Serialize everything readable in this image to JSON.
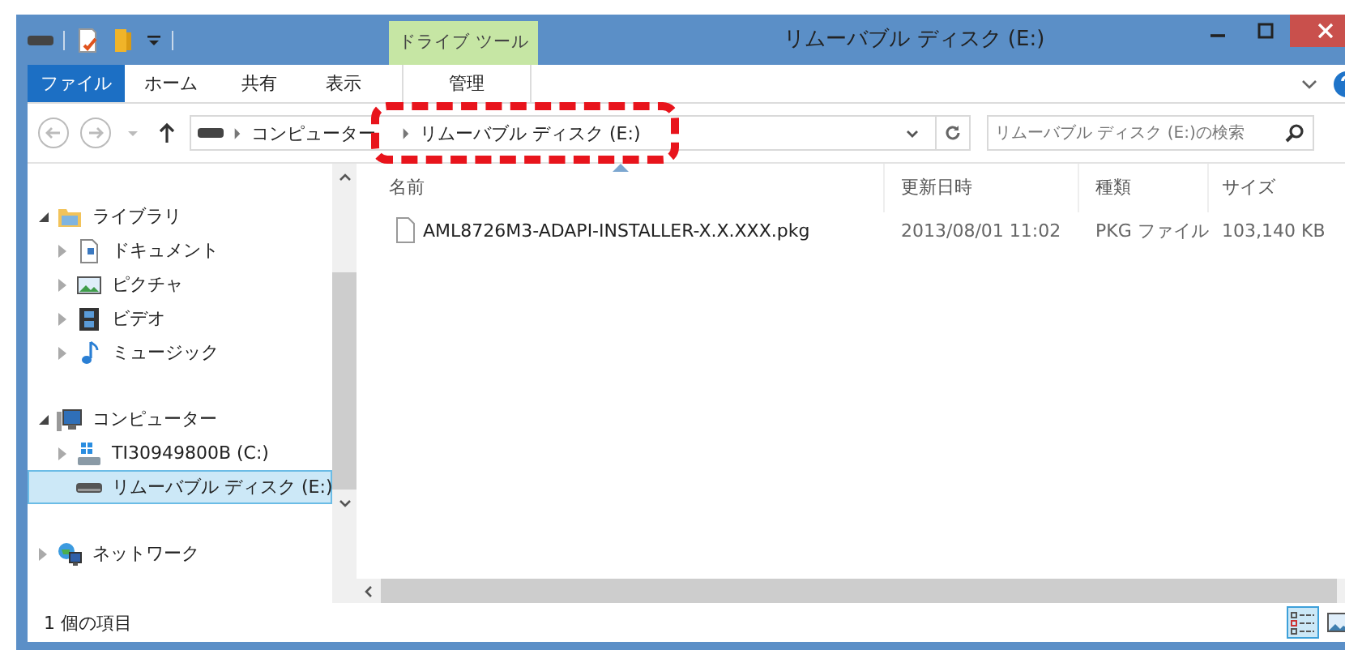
{
  "window": {
    "title": "リムーバブル ディスク (E:)",
    "context_tab": "ドライブ ツール"
  },
  "ribbon_tabs": [
    {
      "label": "ファイル",
      "kind": "file"
    },
    {
      "label": "ホーム",
      "kind": "normal"
    },
    {
      "label": "共有",
      "kind": "normal"
    },
    {
      "label": "表示",
      "kind": "normal"
    },
    {
      "label": "管理",
      "kind": "context"
    }
  ],
  "address": {
    "breadcrumbs": [
      "コンピューター",
      "リムーバブル ディスク (E:)"
    ],
    "search_placeholder": "リムーバブル ディスク (E:)の検索"
  },
  "sidebar": {
    "items": [
      {
        "label": "ライブラリ",
        "kind": "library",
        "expanded": true,
        "selected": false,
        "children": [
          {
            "label": "ドキュメント",
            "kind": "document",
            "expanded": false,
            "selected": false
          },
          {
            "label": "ピクチャ",
            "kind": "picture",
            "expanded": false,
            "selected": false
          },
          {
            "label": "ビデオ",
            "kind": "video",
            "expanded": false,
            "selected": false
          },
          {
            "label": "ミュージック",
            "kind": "music",
            "expanded": false,
            "selected": false
          }
        ]
      },
      {
        "label": "コンピューター",
        "kind": "computer",
        "expanded": true,
        "selected": false,
        "children": [
          {
            "label": "TI30949800B (C:)",
            "kind": "system-drive",
            "expanded": false,
            "selected": false
          },
          {
            "label": "リムーバブル ディスク (E:)",
            "kind": "removable",
            "selected": true
          }
        ]
      },
      {
        "label": "ネットワーク",
        "kind": "network",
        "expanded": false,
        "selected": false
      }
    ]
  },
  "table": {
    "columns": [
      {
        "label": "名前",
        "sorted": true
      },
      {
        "label": "更新日時",
        "sorted": false
      },
      {
        "label": "種類",
        "sorted": false
      },
      {
        "label": "サイズ",
        "sorted": false
      }
    ],
    "rows": [
      {
        "cells": [
          "AML8726M3-ADAPI-INSTALLER-X.X.XXX.pkg",
          "2013/08/01 11:02",
          "PKG ファイル",
          "103,140 KB"
        ]
      }
    ]
  },
  "status_bar": {
    "text": "1 個の項目",
    "views": [
      {
        "kind": "details",
        "selected": true
      },
      {
        "kind": "large-icons",
        "selected": false
      }
    ]
  }
}
